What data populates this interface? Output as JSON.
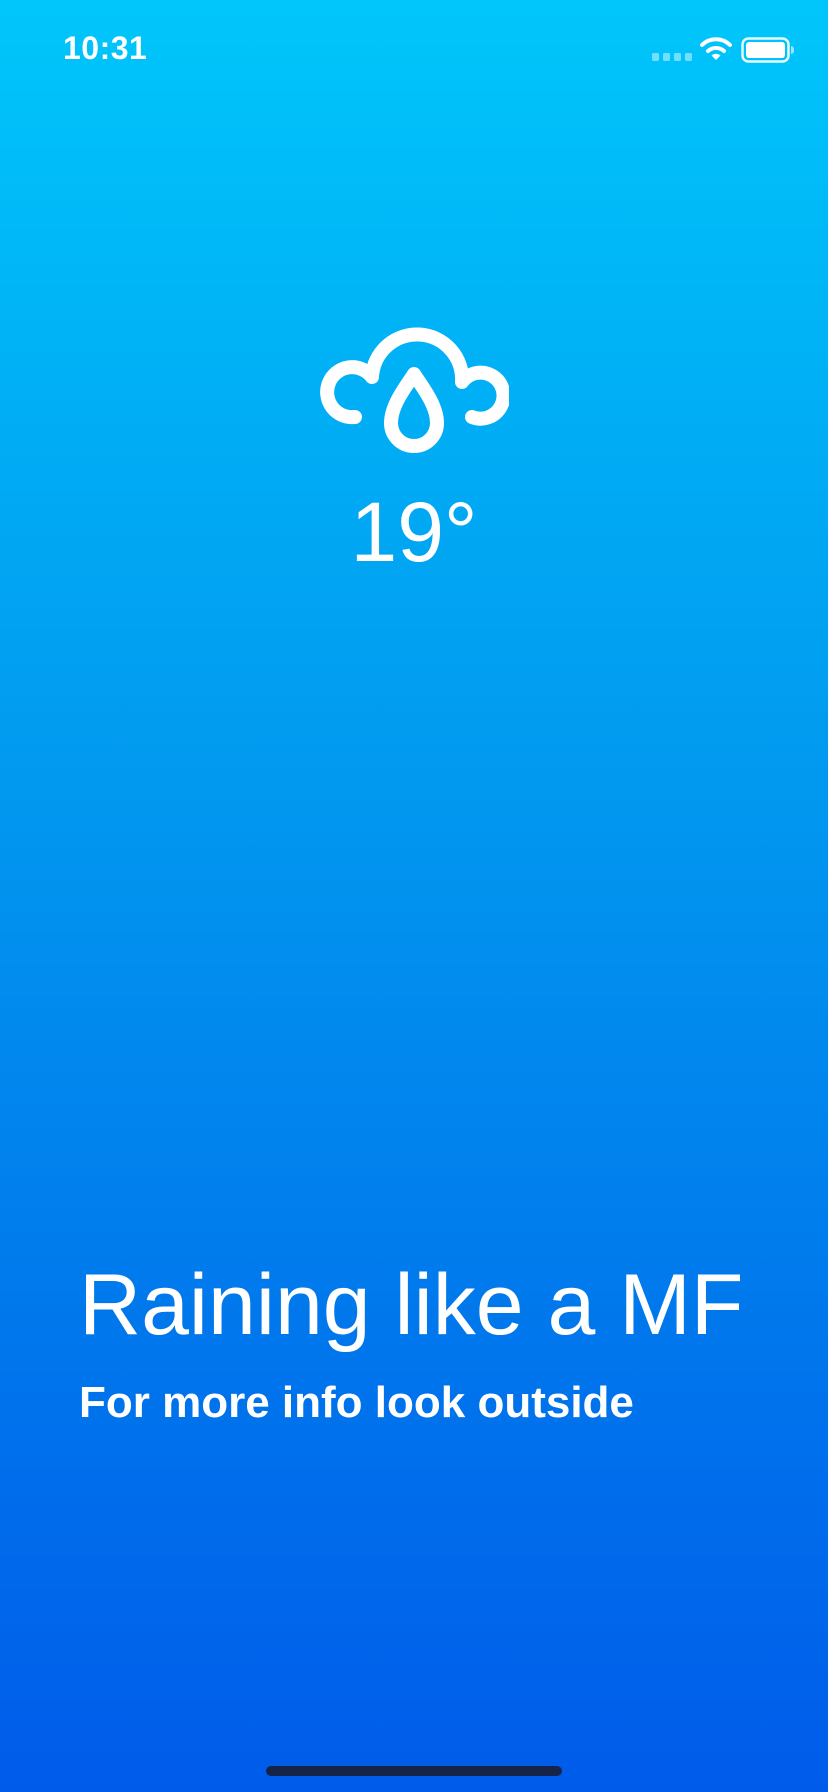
{
  "status_bar": {
    "time": "10:31",
    "icons": [
      "cellular-signal-icon",
      "wifi-icon",
      "battery-icon"
    ]
  },
  "weather": {
    "icon": "cloud-rain-drop-icon",
    "temperature": "19°"
  },
  "message": {
    "headline": "Raining like a MF",
    "subline": "For more info look outside"
  },
  "colors": {
    "gradient_top": "#00c6fb",
    "gradient_bottom": "#005bea",
    "text": "#ffffff"
  }
}
